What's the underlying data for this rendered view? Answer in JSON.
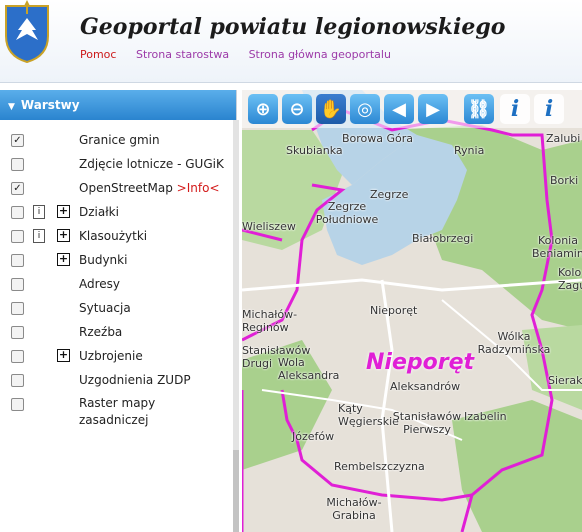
{
  "header": {
    "title": "Geoportal powiatu legionowskiego",
    "links": [
      "Pomoc",
      "Strona starostwa",
      "Strona główna geoportalu"
    ]
  },
  "colors": {
    "panel_header": "#2a84cf",
    "boundary": "#e01fd6",
    "water": "#b7d3e7",
    "forest": "#a9d08d",
    "urban": "#e6e1d9"
  },
  "layers_panel": {
    "title": "Warstwy",
    "items": [
      {
        "label": "Granice gmin",
        "checked": true
      },
      {
        "label": "Zdjęcie lotnicze - GUGiK",
        "checked": false
      },
      {
        "label": "OpenStreetMap",
        "extra": ">Info<",
        "checked": true
      },
      {
        "label": "Działki",
        "checked": false,
        "info": true,
        "expand": true
      },
      {
        "label": "Klasoużytki",
        "checked": false,
        "info": true,
        "expand": true
      },
      {
        "label": "Budynki",
        "checked": false,
        "expand": true
      },
      {
        "label": "Adresy",
        "checked": false
      },
      {
        "label": "Sytuacja",
        "checked": false
      },
      {
        "label": "Rzeźba",
        "checked": false
      },
      {
        "label": "Uzbrojenie",
        "checked": false,
        "expand": true
      },
      {
        "label": "Uzgodnienia ZUDP",
        "checked": false
      },
      {
        "label": "Raster mapy zasadniczej",
        "checked": false
      }
    ]
  },
  "toolbar": {
    "tools": [
      "zoom-in-icon",
      "zoom-out-icon",
      "pan-hand-icon",
      "zoom-extent-icon",
      "back-arrow-icon",
      "forward-arrow-icon",
      "link-icon",
      "info-icon",
      "info-select-icon"
    ],
    "info_glyph": "i"
  },
  "map": {
    "labels": [
      "Borowa Góra",
      "Zalubi",
      "Skubianka",
      "Rynia",
      "Borki",
      "Zegrze",
      "Zegrze Południowe",
      "Wieliszew",
      "Białobrzegi",
      "Kolonia Beniaminów",
      "Kolo Zagu",
      "Michałów-Reginów",
      "Nieporęt",
      "Wólka Radzymińska",
      "Stanisławów Drugi",
      "Wola Aleksandra",
      "Aleksandrów",
      "Sierakó",
      "Kąty Węgierskie",
      "Stanisławów Pierwszy",
      "Izabelin",
      "Józefów",
      "Rembelszczyzna",
      "Michałów-Grabina"
    ],
    "commune": "Nieporęt"
  }
}
